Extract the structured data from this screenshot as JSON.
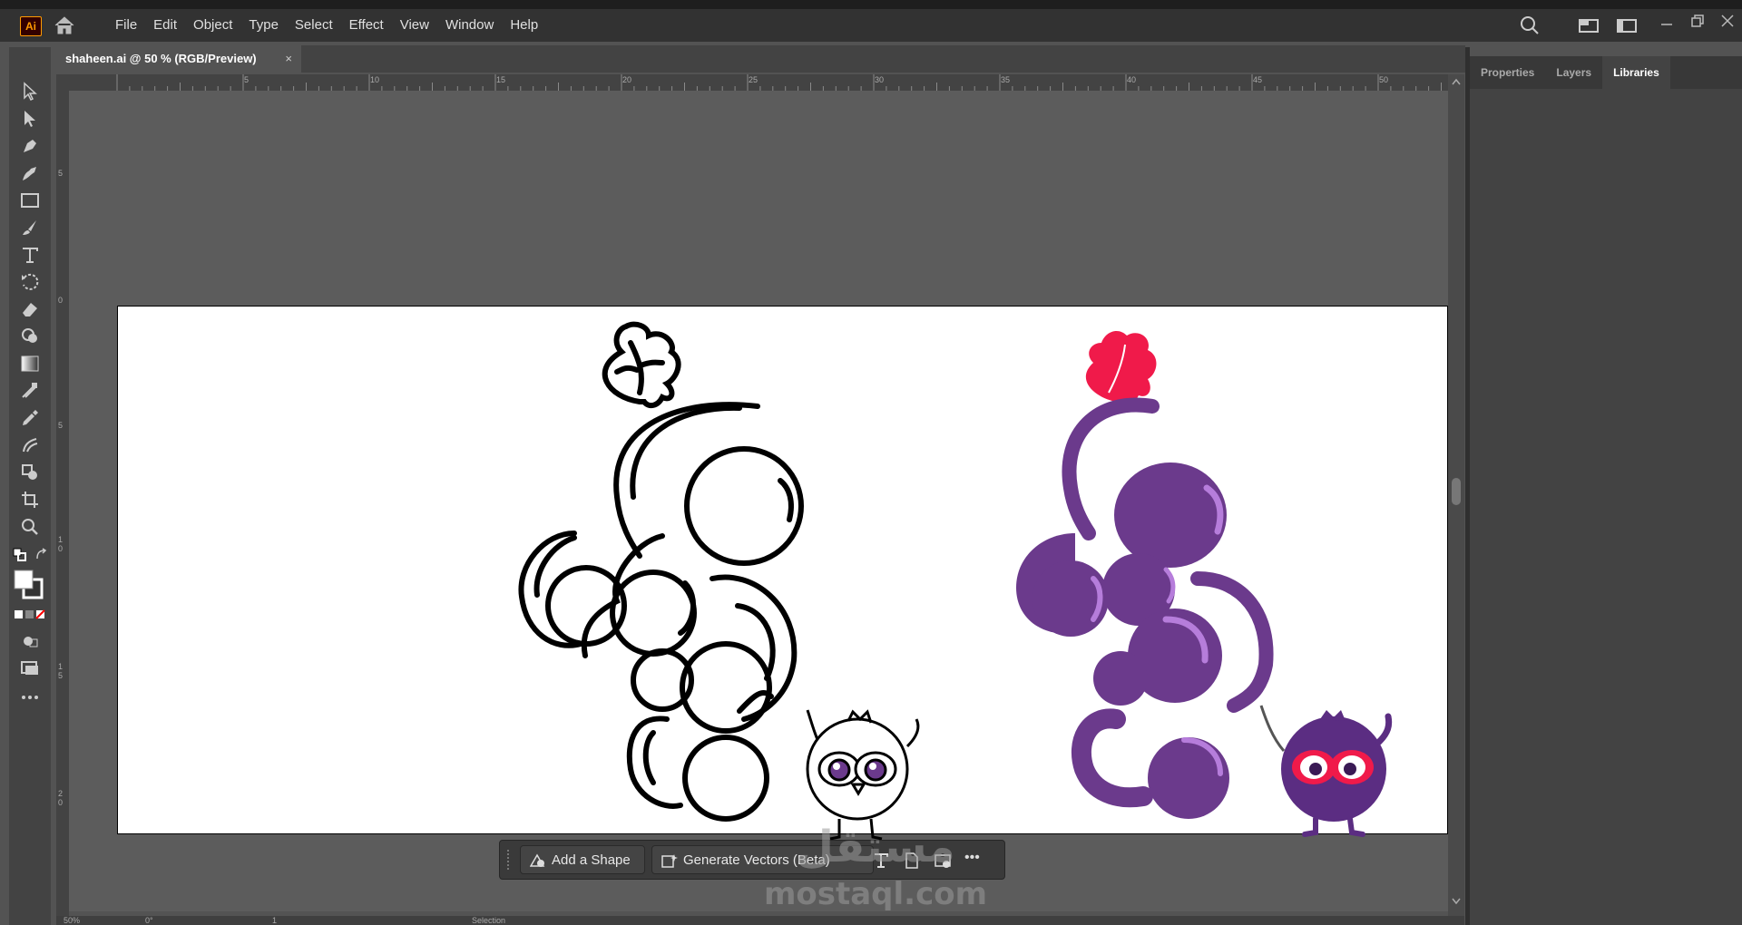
{
  "app": {
    "logo_text": "Ai"
  },
  "menu": [
    "File",
    "Edit",
    "Object",
    "Type",
    "Select",
    "Effect",
    "View",
    "Window",
    "Help"
  ],
  "document_tab": {
    "title": "shaheen.ai @ 50 % (RGB/Preview)",
    "close": "×"
  },
  "ruler": {
    "h_ticks": [
      "5",
      "10",
      "15",
      "20",
      "25",
      "30",
      "35",
      "40",
      "45",
      "50"
    ],
    "v_ticks": [
      "5",
      "0",
      "5",
      "1 0",
      "1 5",
      "2 0"
    ]
  },
  "panel_tabs": [
    "Properties",
    "Layers",
    "Libraries"
  ],
  "active_panel": "Libraries",
  "context_bar": {
    "add_shape": "Add a Shape",
    "generate_vectors": "Generate Vectors (Beta)",
    "more": "•••"
  },
  "status_bar": {
    "zoom": "50%",
    "angle": "0°",
    "artboard": "1",
    "tool": "Selection"
  },
  "watermark": {
    "arabic": "مستقل",
    "latin": "mostaql.com"
  },
  "colors": {
    "grape_purple": "#6b3a8c",
    "leaf_red": "#f01a4a",
    "outline": "#000000"
  }
}
